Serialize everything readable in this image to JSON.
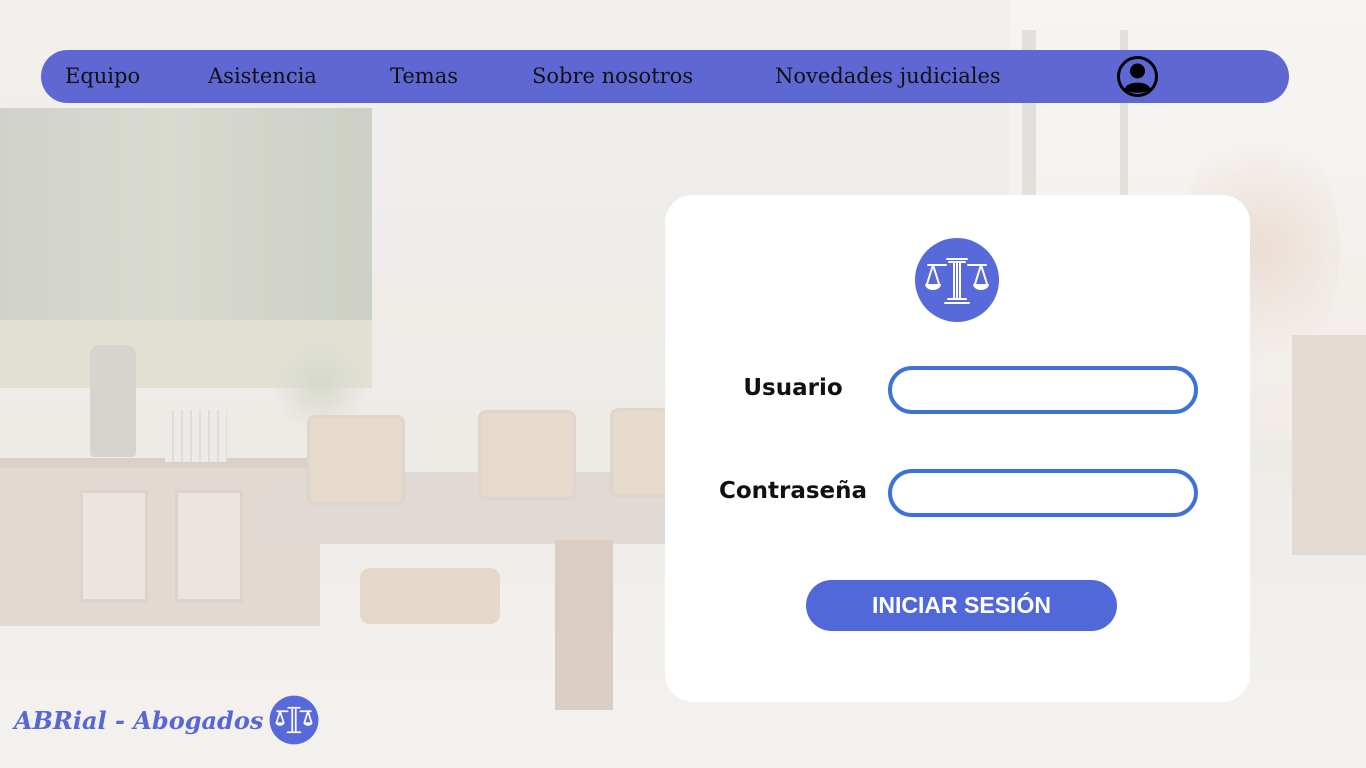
{
  "nav": {
    "items": [
      {
        "label": "Equipo"
      },
      {
        "label": "Asistencia"
      },
      {
        "label": "Temas"
      },
      {
        "label": "Sobre nosotros"
      },
      {
        "label": "Novedades judiciales"
      }
    ],
    "user_icon": "user-account-icon"
  },
  "login": {
    "logo_icon": "scales-of-justice-icon",
    "username_label": "Usuario",
    "username_value": "",
    "password_label": "Contraseña",
    "password_value": "",
    "submit_label": "INICIAR SESIÓN"
  },
  "footer": {
    "brand": "ABRial - Abogados",
    "logo_icon": "scales-of-justice-icon"
  },
  "colors": {
    "nav_background": "#5f67d2",
    "input_border": "#3f72d6",
    "button_background": "#5169d8",
    "brand_text": "#5967d3"
  }
}
